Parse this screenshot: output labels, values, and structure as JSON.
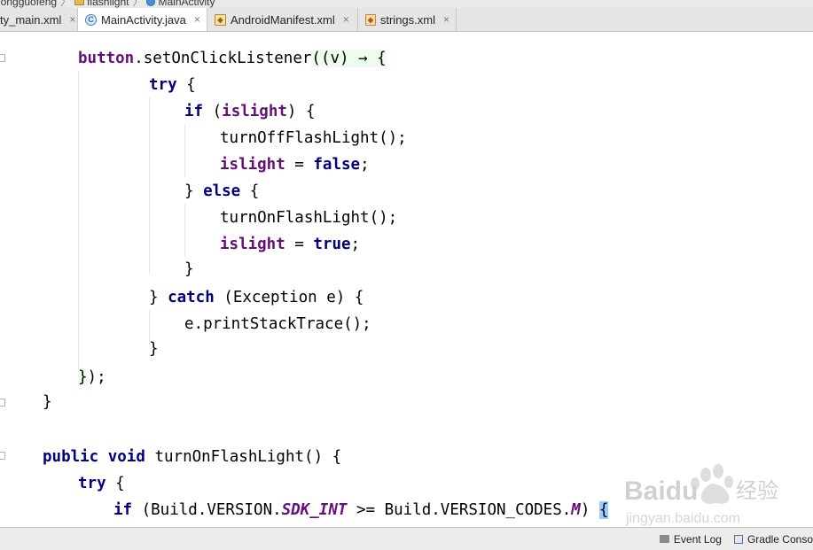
{
  "breadcrumbs": [
    {
      "label": "nongguofeng",
      "icon": "project-icon"
    },
    {
      "label": "flashlight",
      "icon": "folder-icon"
    },
    {
      "label": "MainActivity",
      "icon": "class-icon"
    }
  ],
  "tabs": [
    {
      "label": "ty_main.xml",
      "icon": "xml-layout-icon",
      "active": false
    },
    {
      "label": "MainActivity.java",
      "icon": "java-class-icon",
      "active": true
    },
    {
      "label": "AndroidManifest.xml",
      "icon": "manifest-icon",
      "active": false
    },
    {
      "label": "strings.xml",
      "icon": "strings-xml-icon",
      "active": false
    }
  ],
  "tab_close_glyph": "×",
  "code_lines": [
    "button.setOnClickListener((v) → {",
    "try {",
    "if (islight) {",
    "turnOffFlashLight();",
    "islight = false;",
    "} else {",
    "turnOnFlashLight();",
    "islight = true;",
    "}",
    "} catch (Exception e) {",
    "e.printStackTrace();",
    "}",
    "});",
    "}",
    "",
    "public void turnOnFlashLight() {",
    "try {",
    "if (Build.VERSION.SDK_INT >= Build.VERSION_CODES.M) {"
  ],
  "status": {
    "event_log": "Event Log",
    "gradle_console": "Gradle Conso"
  },
  "watermark": {
    "brand": "Baidu",
    "cn": "经验",
    "url": "jingyan.baidu.com"
  },
  "colors": {
    "keyword": "#000080",
    "field": "#660e7a",
    "tab_active": "#ffffff",
    "tab_bar": "#e5e5e5"
  }
}
